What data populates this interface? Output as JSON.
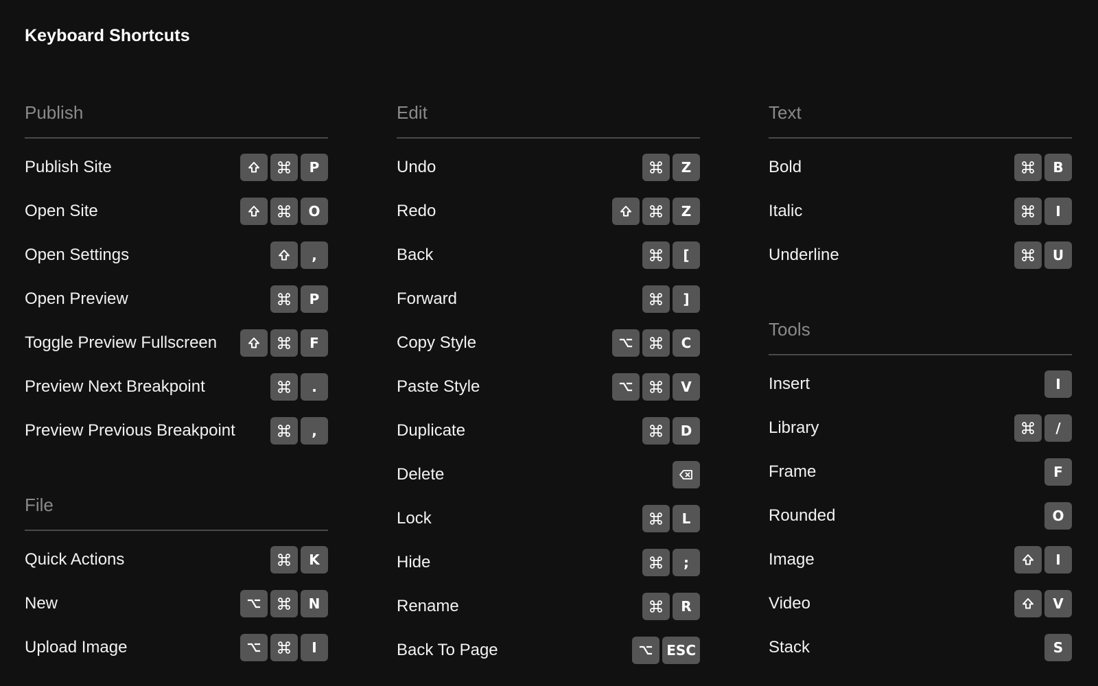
{
  "page": {
    "title": "Keyboard Shortcuts"
  },
  "colors": {
    "background": "#111111",
    "key_background": "#555555",
    "section_header": "#8a8a8a",
    "divider": "#4a4a4a",
    "text": "#f2f2f2"
  },
  "key_glyphs": {
    "shift": "⇧",
    "cmd": "⌘",
    "option": "⌥",
    "delete": "⌫"
  },
  "columns": [
    {
      "sections": [
        {
          "title": "Publish",
          "items": [
            {
              "label": "Publish Site",
              "keys": [
                "shift",
                "cmd",
                "P"
              ]
            },
            {
              "label": "Open Site",
              "keys": [
                "shift",
                "cmd",
                "O"
              ]
            },
            {
              "label": "Open Settings",
              "keys": [
                "shift",
                ","
              ]
            },
            {
              "label": "Open Preview",
              "keys": [
                "cmd",
                "P"
              ]
            },
            {
              "label": "Toggle Preview Fullscreen",
              "keys": [
                "shift",
                "cmd",
                "F"
              ]
            },
            {
              "label": "Preview Next Breakpoint",
              "keys": [
                "cmd",
                "."
              ]
            },
            {
              "label": "Preview Previous Breakpoint",
              "keys": [
                "cmd",
                ","
              ]
            }
          ]
        },
        {
          "title": "File",
          "items": [
            {
              "label": "Quick Actions",
              "keys": [
                "cmd",
                "K"
              ]
            },
            {
              "label": "New",
              "keys": [
                "option",
                "cmd",
                "N"
              ]
            },
            {
              "label": "Upload Image",
              "keys": [
                "option",
                "cmd",
                "I"
              ]
            }
          ]
        }
      ]
    },
    {
      "sections": [
        {
          "title": "Edit",
          "items": [
            {
              "label": "Undo",
              "keys": [
                "cmd",
                "Z"
              ]
            },
            {
              "label": "Redo",
              "keys": [
                "shift",
                "cmd",
                "Z"
              ]
            },
            {
              "label": "Back",
              "keys": [
                "cmd",
                "["
              ]
            },
            {
              "label": "Forward",
              "keys": [
                "cmd",
                "]"
              ]
            },
            {
              "label": "Copy Style",
              "keys": [
                "option",
                "cmd",
                "C"
              ]
            },
            {
              "label": "Paste Style",
              "keys": [
                "option",
                "cmd",
                "V"
              ]
            },
            {
              "label": "Duplicate",
              "keys": [
                "cmd",
                "D"
              ]
            },
            {
              "label": "Delete",
              "keys": [
                "delete"
              ]
            },
            {
              "label": "Lock",
              "keys": [
                "cmd",
                "L"
              ]
            },
            {
              "label": "Hide",
              "keys": [
                "cmd",
                ";"
              ]
            },
            {
              "label": "Rename",
              "keys": [
                "cmd",
                "R"
              ]
            },
            {
              "label": "Back To Page",
              "keys": [
                "option",
                "ESC"
              ]
            }
          ]
        }
      ]
    },
    {
      "sections": [
        {
          "title": "Text",
          "items": [
            {
              "label": "Bold",
              "keys": [
                "cmd",
                "B"
              ]
            },
            {
              "label": "Italic",
              "keys": [
                "cmd",
                "I"
              ]
            },
            {
              "label": "Underline",
              "keys": [
                "cmd",
                "U"
              ]
            }
          ]
        },
        {
          "title": "Tools",
          "items": [
            {
              "label": "Insert",
              "keys": [
                "I"
              ]
            },
            {
              "label": "Library",
              "keys": [
                "cmd",
                "/"
              ]
            },
            {
              "label": "Frame",
              "keys": [
                "F"
              ]
            },
            {
              "label": "Rounded",
              "keys": [
                "O"
              ]
            },
            {
              "label": "Image",
              "keys": [
                "shift",
                "I"
              ]
            },
            {
              "label": "Video",
              "keys": [
                "shift",
                "V"
              ]
            },
            {
              "label": "Stack",
              "keys": [
                "S"
              ]
            }
          ]
        }
      ]
    }
  ]
}
